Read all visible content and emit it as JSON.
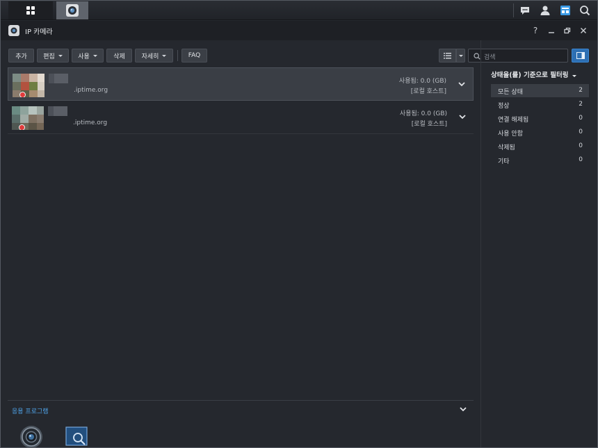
{
  "window": {
    "title": "IP 카메라"
  },
  "toolbar": {
    "add_label": "추가",
    "edit_label": "편집",
    "use_label": "사용",
    "delete_label": "삭제",
    "detail_label": "자세히",
    "faq_label": "FAQ",
    "search_placeholder": "검색"
  },
  "cameras": [
    {
      "host": ".iptime.org",
      "usage": "사용됨: 0.0 (GB)",
      "location": "[로컬 호스트]"
    },
    {
      "host": ".iptime.org",
      "usage": "사용됨: 0.0 (GB)",
      "location": "[로컬 호스트]"
    }
  ],
  "filter": {
    "title": "상태을(를) 기준으로 필터링",
    "items": [
      {
        "label": "모든 상태",
        "count": "2"
      },
      {
        "label": "정상",
        "count": "2"
      },
      {
        "label": "연결 해제됨",
        "count": "0"
      },
      {
        "label": "사용 안함",
        "count": "0"
      },
      {
        "label": "삭제됨",
        "count": "0"
      },
      {
        "label": "기타",
        "count": "0"
      }
    ]
  },
  "apps": {
    "title": "응용 프로그램"
  },
  "colors": {
    "accent": "#4fa3e8",
    "record": "#e03b3b",
    "background": "#25282e"
  }
}
